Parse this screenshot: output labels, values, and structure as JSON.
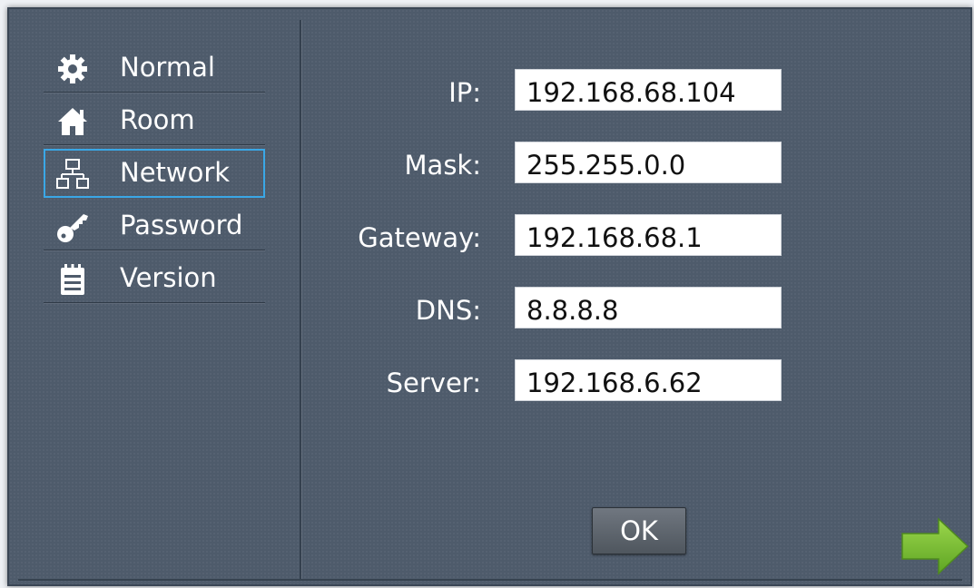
{
  "sidebar": {
    "items": [
      {
        "label": "Normal",
        "icon": "gear-icon"
      },
      {
        "label": "Room",
        "icon": "house-icon"
      },
      {
        "label": "Network",
        "icon": "network-icon",
        "selected": true
      },
      {
        "label": "Password",
        "icon": "key-icon"
      },
      {
        "label": "Version",
        "icon": "notepad-icon"
      }
    ]
  },
  "form": {
    "fields": [
      {
        "label": "IP:",
        "value": "192.168.68.104"
      },
      {
        "label": "Mask:",
        "value": "255.255.0.0"
      },
      {
        "label": "Gateway:",
        "value": "192.168.68.1"
      },
      {
        "label": "DNS:",
        "value": "8.8.8.8"
      },
      {
        "label": "Server:",
        "value": "192.168.6.62"
      }
    ],
    "ok_label": "OK"
  },
  "nav": {
    "next_icon": "arrow-right-icon"
  },
  "colors": {
    "background": "#4e5b6b",
    "selected_border": "#3aa7e6",
    "arrow": "#7fc23a"
  }
}
